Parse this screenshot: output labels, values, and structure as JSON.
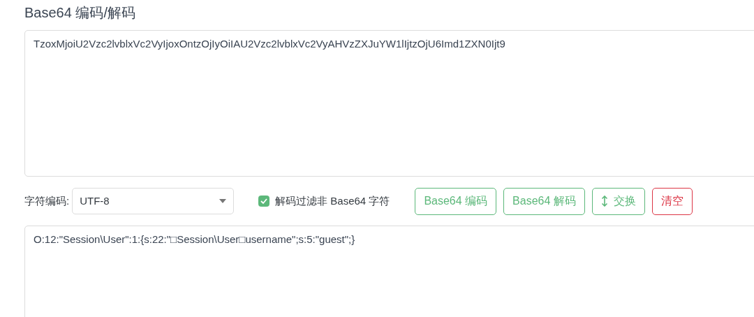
{
  "title": "Base64 编码/解码",
  "input": {
    "value": "TzoxMjoiU2Vzc2lvblxVc2VyIjoxOntzOjIyOiIAU2Vzc2lvblxVc2VyAHVzZXJuYW1lIjtzOjU6Imd1ZXN0Ijt9"
  },
  "charset": {
    "label": "字符编码:",
    "value": "UTF-8"
  },
  "filter": {
    "label": "解码过滤非 Base64 字符",
    "checked": true
  },
  "buttons": [
    {
      "label": "Base64 编码",
      "kind": "success"
    },
    {
      "label": "Base64 解码",
      "kind": "success"
    },
    {
      "label": "交换",
      "kind": "swap"
    },
    {
      "label": "清空",
      "kind": "danger"
    }
  ],
  "output": {
    "value": "O:12:\"Session\\User\":1:{s:22:\"□Session\\User□username\";s:5:\"guest\";}"
  }
}
